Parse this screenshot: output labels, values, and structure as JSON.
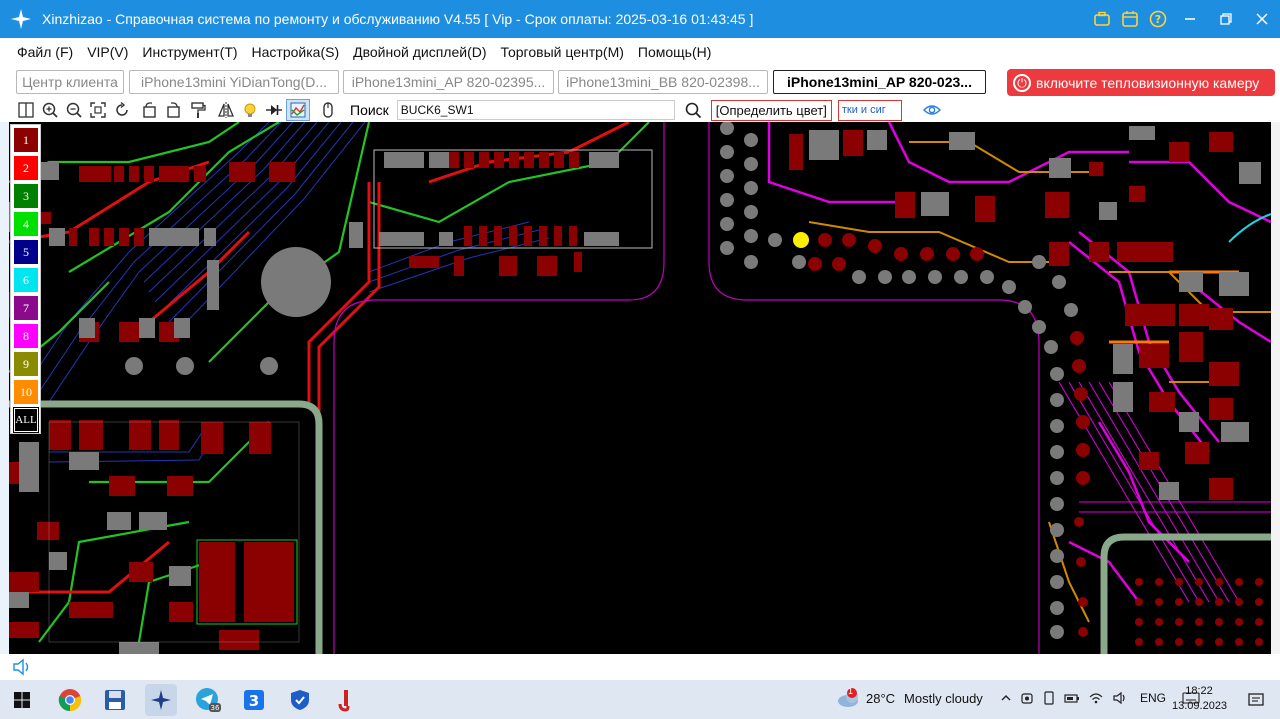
{
  "window": {
    "title": "Xinzhizao - Справочная система по ремонту и обслуживанию V4.55 [ Vip - Срок оплаты: 2025-03-16 01:43:45 ]"
  },
  "menu": {
    "items": [
      "Файл (F)",
      "VIP(V)",
      "Инструмент(T)",
      "Настройка(S)",
      "Двойной дисплей(D)",
      "Торговый центр(M)",
      "Помощь(H)"
    ]
  },
  "tabs": [
    {
      "label": "Центр клиента",
      "active": false
    },
    {
      "label": "iPhone13mini YiDianTong(D...",
      "active": false
    },
    {
      "label": "iPhone13mini_AP 820-02395...",
      "active": false
    },
    {
      "label": "iPhone13mini_BB 820-02398...",
      "active": false
    },
    {
      "label": "iPhone13mini_AP 820-023...",
      "active": true
    }
  ],
  "thermal_button": {
    "label": "включите тепловизионную камеру",
    "color": "#ec3a3f"
  },
  "toolbar": {
    "search_label": "Поиск",
    "search_value": "BUCK6_SW1",
    "color_button": "[Определить цвет]",
    "signal_button": "тки и сиг"
  },
  "layers": [
    {
      "label": "1",
      "bg": "#8b0000",
      "fg": "#ffffff"
    },
    {
      "label": "2",
      "bg": "#ff0000",
      "fg": "#ffffff"
    },
    {
      "label": "3",
      "bg": "#008000",
      "fg": "#ffffff"
    },
    {
      "label": "4",
      "bg": "#00e000",
      "fg": "#ffffff"
    },
    {
      "label": "5",
      "bg": "#00008b",
      "fg": "#ffffff"
    },
    {
      "label": "6",
      "bg": "#00e5ee",
      "fg": "#ffffff"
    },
    {
      "label": "7",
      "bg": "#8b0a8b",
      "fg": "#ffffff"
    },
    {
      "label": "8",
      "bg": "#ff00ff",
      "fg": "#ffffff"
    },
    {
      "label": "9",
      "bg": "#8b8b00",
      "fg": "#ffffff"
    },
    {
      "label": "10",
      "bg": "#ff8c00",
      "fg": "#ffffff"
    },
    {
      "label": "ALL",
      "bg": "#000000",
      "fg": "#ffffff"
    }
  ],
  "taskbar": {
    "weather_temp": "28°C",
    "weather_text": "Mostly cloudy",
    "language": "ENG",
    "time": "18:22",
    "date": "13.09.2023",
    "badge": "1",
    "app_badge": "36"
  },
  "colors": {
    "titlebar": "#1e8fe0",
    "board_bg": "#000000",
    "pad_red": "#8b0000",
    "pad_gray": "#7a7a7a",
    "trace_green": "#22c322",
    "trace_magenta": "#e000e0",
    "trace_blue": "#3040d0",
    "outline": "#a0c0a0"
  }
}
